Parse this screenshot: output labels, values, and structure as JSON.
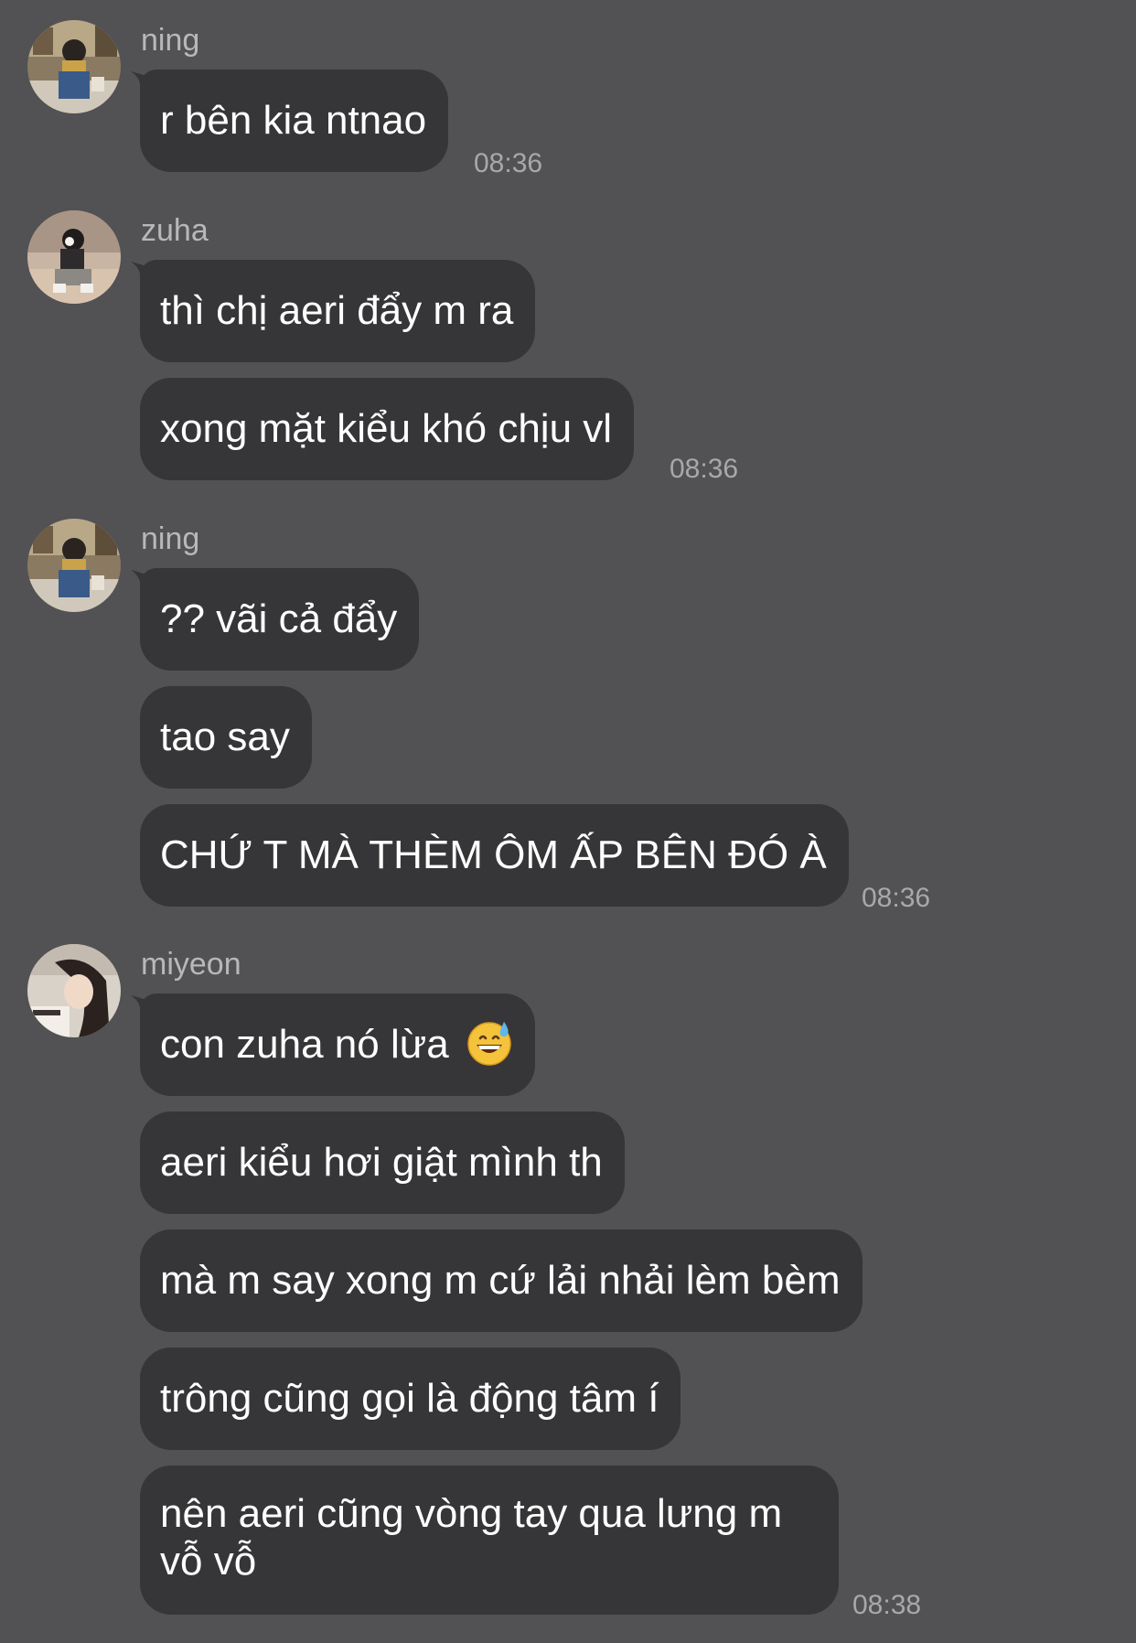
{
  "colors": {
    "background": "#525153",
    "bubble": "#363638",
    "sender_name": "#b8b7b9",
    "timestamp": "#a8a7aa",
    "message_text": "#ffffff"
  },
  "groups": [
    {
      "sender": "ning",
      "avatar_icon": "ning-avatar",
      "messages": [
        "r bên kia ntnao"
      ],
      "time": "08:36"
    },
    {
      "sender": "zuha",
      "avatar_icon": "zuha-avatar",
      "messages": [
        "thì chị aeri đẩy m ra",
        "xong mặt kiểu khó chịu vl"
      ],
      "time": "08:36"
    },
    {
      "sender": "ning",
      "avatar_icon": "ning-avatar",
      "messages": [
        "?? vãi cả đẩy",
        "tao say",
        "CHỨ T MÀ THÈM ÔM ẤP BÊN ĐÓ À"
      ],
      "time": "08:36"
    },
    {
      "sender": "miyeon",
      "avatar_icon": "miyeon-avatar",
      "messages": [
        "con zuha nó lừa",
        "aeri kiểu hơi giật mình th",
        "mà m say xong m cứ lải nhải lèm bèm",
        "trông cũng gọi là động tâm í",
        "nên aeri cũng vòng tay qua lưng m vỗ vỗ"
      ],
      "time": "08:38",
      "emoji": "grinning-face-with-sweat-emoji"
    }
  ]
}
